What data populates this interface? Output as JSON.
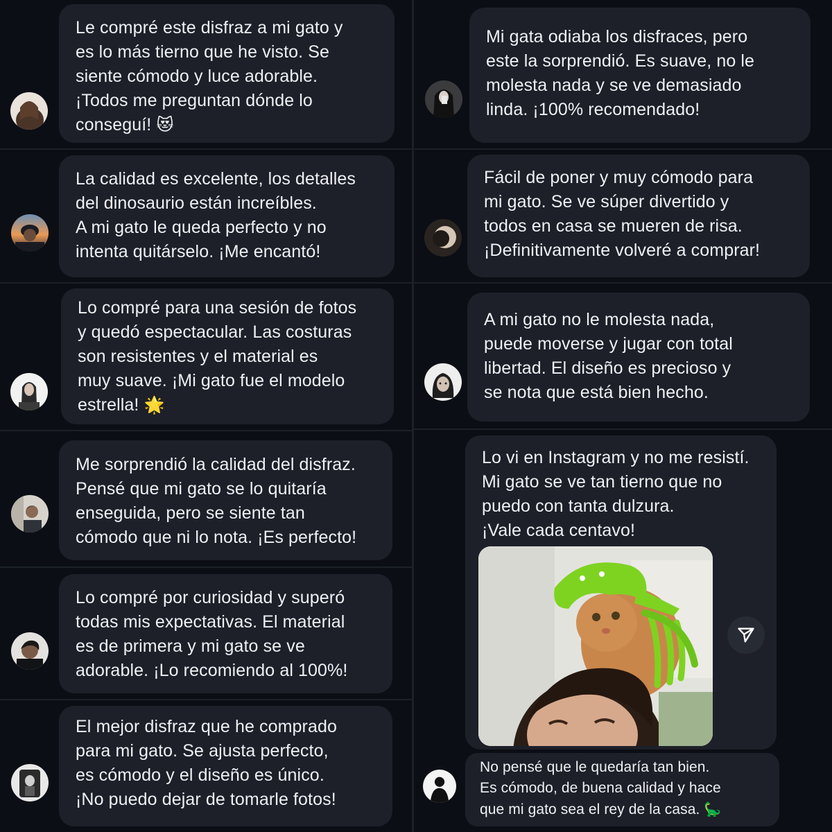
{
  "reviews": [
    {
      "text": "Le compré este disfraz a mi gato y\nes lo más tierno que he visto. Se\nsiente cómodo y luce adorable.\n¡Todos me preguntan dónde lo\nconseguí!",
      "emoji": "😻"
    },
    {
      "text": "La calidad es excelente, los detalles\ndel dinosaurio están increíbles.\nA mi gato le queda perfecto y no\nintenta quitárselo. ¡Me encantó!"
    },
    {
      "text": "Lo compré para una sesión de fotos\ny quedó espectacular. Las costuras\nson resistentes y el material es\nmuy suave. ¡Mi gato fue el modelo\nestrella!",
      "emoji": "🌟"
    },
    {
      "text": "Me sorprendió la calidad del disfraz.\nPensé que mi gato se lo quitaría\nenseguida, pero se siente tan\ncómodo que ni lo nota. ¡Es perfecto!"
    },
    {
      "text": "Lo compré por curiosidad y superó\ntodas mis expectativas. El material\nes de primera y mi gato se ve\nadorable. ¡Lo recomiendo al 100%!"
    },
    {
      "text": "El mejor disfraz que he comprado\npara mi gato. Se ajusta perfecto,\nes cómodo y el diseño es único.\n¡No puedo dejar de tomarle fotos!"
    },
    {
      "text": "Mi gata odiaba los disfraces, pero\neste la sorprendió. Es suave, no le\nmolesta nada y se ve demasiado\nlinda. ¡100% recomendado!"
    },
    {
      "text": "Fácil de poner y muy cómodo para\nmi gato. Se ve súper divertido y\ntodos en casa se mueren de risa.\n¡Definitivamente volveré a comprar!"
    },
    {
      "text": "A mi gato no le molesta nada,\npuede moverse y jugar con total\nlibertad. El diseño es precioso y\nse nota que está bien hecho."
    },
    {
      "text": "Lo vi en Instagram y no me resistí.\nMi gato se ve tan tierno que no\npuedo con tanta dulzura.\n¡Vale cada centavo!"
    },
    {
      "text": "No pensé que le quedaría tan bien.\nEs cómodo, de buena calidad y hace\nque mi gato sea el rey de la casa.",
      "emoji": "🦕"
    }
  ],
  "icons": {
    "send": "send-icon",
    "photo": "cat-dinosaur-costume-photo"
  },
  "colors": {
    "background": "#0b0e14",
    "bubble": "#1d2029",
    "text": "#eef0f3",
    "dino_green": "#7ed321"
  }
}
